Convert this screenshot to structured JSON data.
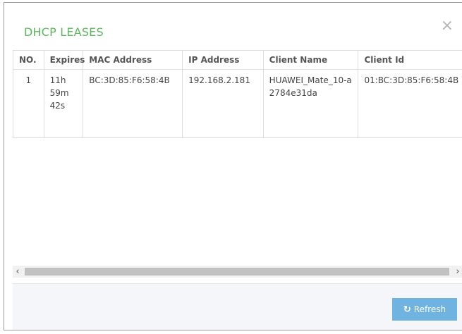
{
  "modal": {
    "title": "DHCP LEASES",
    "close_glyph": "×"
  },
  "table": {
    "headers": {
      "no": "NO.",
      "expires": "Expires",
      "mac": "MAC Address",
      "ip": "IP Address",
      "client_name": "Client Name",
      "client_id": "Client Id"
    },
    "rows": [
      {
        "no": "1",
        "expires": "11h 59m 42s",
        "mac": "BC:3D:85:F6:58:4B",
        "ip": "192.168.2.181",
        "client_name": "HUAWEI_Mate_10-a2784e31da",
        "client_id": "01:BC:3D:85:F6:58:4B"
      }
    ]
  },
  "scrollbar": {
    "left_arrow": "‹",
    "right_arrow": "›"
  },
  "footer": {
    "refresh_label": "Refresh",
    "refresh_icon": "refresh-icon",
    "button_color": "#6fb4e0"
  },
  "colors": {
    "title": "#5cb85c"
  }
}
